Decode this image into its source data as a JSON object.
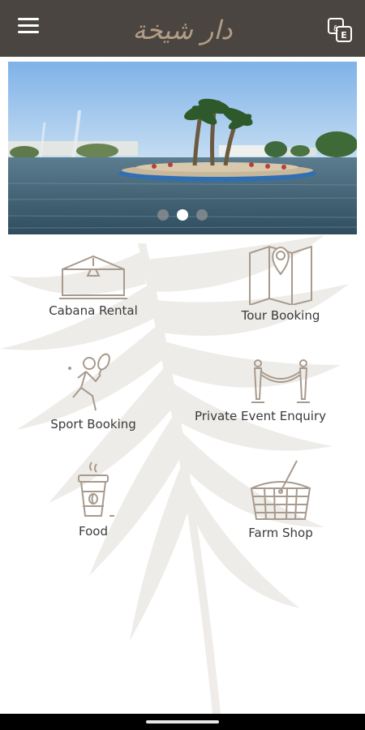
{
  "header": {
    "logo_text": "دار شيخة",
    "menu_icon": "hamburger-menu-icon",
    "language_icon": "language-switch-icon",
    "language_glyphs": [
      "ع",
      "E"
    ]
  },
  "banner": {
    "description_icon": "lake-with-palm-island-photo",
    "slide_count": 3,
    "active_slide": 2
  },
  "services": [
    {
      "label": "Cabana Rental",
      "icon": "cabana-icon"
    },
    {
      "label": "Tour Booking",
      "icon": "map-pin-icon"
    },
    {
      "label": "Sport Booking",
      "icon": "tennis-player-icon"
    },
    {
      "label": "Private Event Enquiry",
      "icon": "stanchion-rope-icon"
    },
    {
      "label": "Food",
      "icon": "coffee-cup-icon"
    },
    {
      "label": "Farm Shop",
      "icon": "shopping-basket-icon"
    }
  ],
  "colors": {
    "header_bg": "#4a4540",
    "logo": "#b29c86",
    "icon_stroke": "#a89a8d"
  }
}
